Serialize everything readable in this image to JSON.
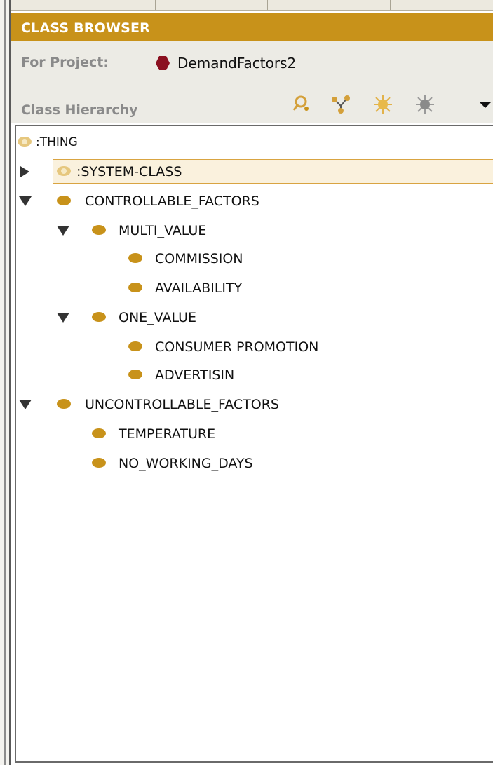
{
  "window": {
    "title": "CLASS BROWSER"
  },
  "project": {
    "label": "For Project:",
    "name": "DemandFactors2",
    "icon": "project-hexagon-icon",
    "icon_color": "#8b1020"
  },
  "hierarchy": {
    "label": "Class Hierarchy",
    "toolbar": [
      {
        "name": "find-class-icon"
      },
      {
        "name": "add-subclass-icon"
      },
      {
        "name": "create-class-icon"
      },
      {
        "name": "delete-class-icon"
      },
      {
        "name": "dropdown-arrow-icon"
      }
    ]
  },
  "tree": {
    "nodes": [
      {
        "label": ":THING",
        "expanded": null,
        "selected": false,
        "system": true
      },
      {
        "label": ":SYSTEM-CLASS",
        "expanded": false,
        "selected": true,
        "system": true
      },
      {
        "label": "CONTROLLABLE_FACTORS",
        "expanded": true,
        "selected": false
      },
      {
        "label": "MULTI_VALUE",
        "expanded": true,
        "selected": false
      },
      {
        "label": "COMMISSION",
        "expanded": null,
        "selected": false
      },
      {
        "label": "AVAILABILITY",
        "expanded": null,
        "selected": false
      },
      {
        "label": "ONE_VALUE",
        "expanded": true,
        "selected": false
      },
      {
        "label": "CONSUMER PROMOTION",
        "expanded": null,
        "selected": false
      },
      {
        "label": "ADVERTISIN",
        "expanded": null,
        "selected": false
      },
      {
        "label": "UNCONTROLLABLE_FACTORS",
        "expanded": true,
        "selected": false
      },
      {
        "label": "TEMPERATURE",
        "expanded": null,
        "selected": false
      },
      {
        "label": "NO_WORKING_DAYS",
        "expanded": null,
        "selected": false
      }
    ]
  },
  "colors": {
    "accent": "#c8921a",
    "selection_border": "#d9a441",
    "selection_fill": "#faf1dd"
  }
}
